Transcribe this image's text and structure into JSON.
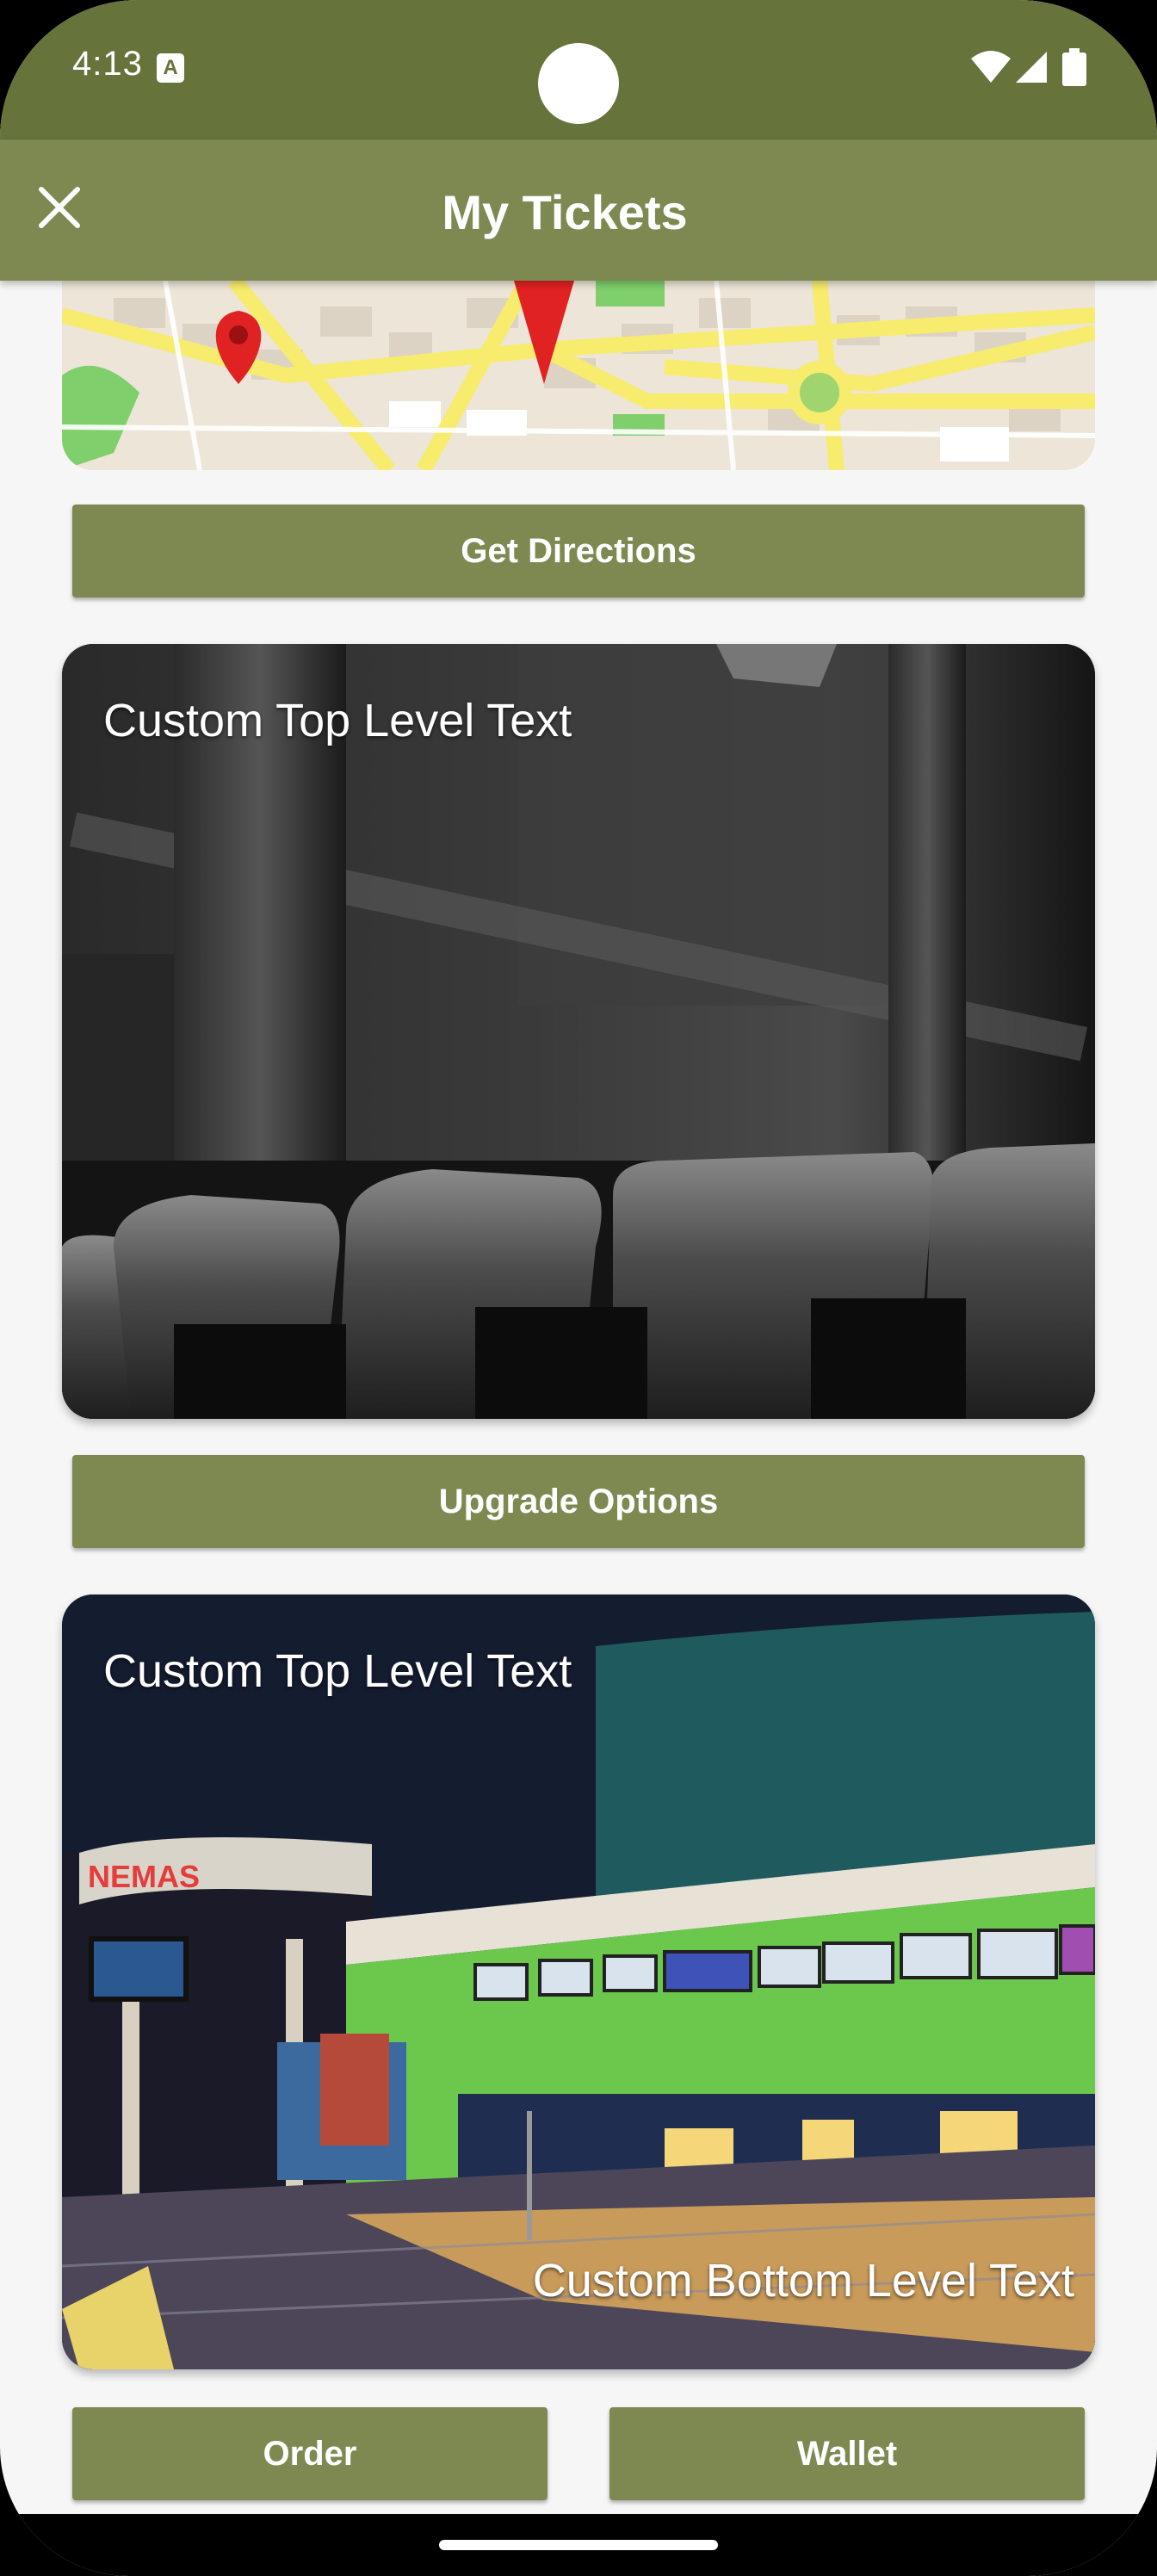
{
  "status_bar": {
    "time": "4:13",
    "notification_icon_letter": "A"
  },
  "app_bar": {
    "title": "My Tickets",
    "close_icon": "close-icon"
  },
  "buttons": {
    "get_directions": "Get Directions",
    "upgrade_options": "Upgrade Options",
    "order": "Order",
    "wallet": "Wallet"
  },
  "cards": [
    {
      "top_text": "Custom Top Level Text",
      "image": "theater-seats-photo"
    },
    {
      "top_text": "Custom Top Level Text",
      "bottom_text": "Custom Bottom Level Text",
      "image": "cinema-lobby-photo"
    }
  ],
  "colors": {
    "status_bar": "#66733a",
    "app_bar": "#7d8950",
    "button": "#7d8950",
    "background": "#f6f6f6"
  }
}
